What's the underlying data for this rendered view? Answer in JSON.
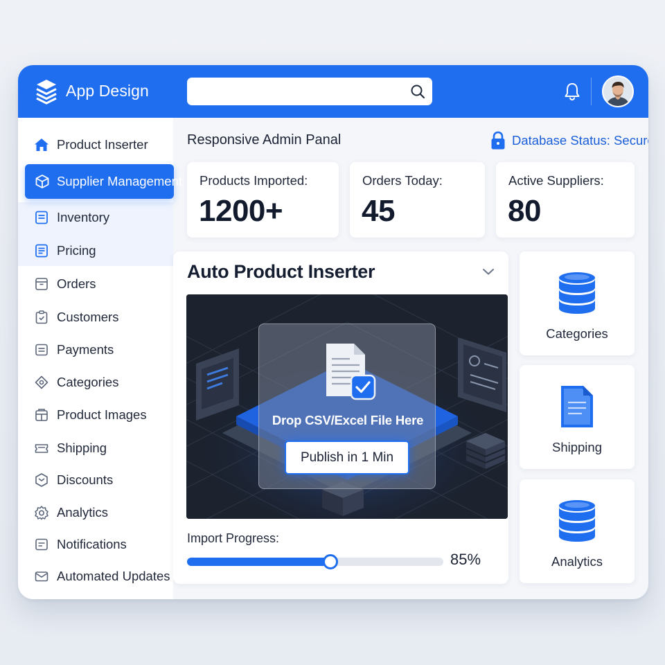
{
  "app": {
    "title": "App Design",
    "logo_icon": "layers-icon"
  },
  "search": {
    "value": "",
    "placeholder": "",
    "icon": "search-icon"
  },
  "header": {
    "notification_icon": "bell-icon",
    "avatar": "user-avatar"
  },
  "sidebar": {
    "active_index": 1,
    "items": [
      {
        "label": "Product Inserter",
        "icon": "home-icon"
      },
      {
        "label": "Supplier Management",
        "icon": "box-icon"
      },
      {
        "label": "Inventory",
        "icon": "list-icon"
      },
      {
        "label": "Pricing",
        "icon": "list-icon"
      },
      {
        "label": "Orders",
        "icon": "tray-icon"
      },
      {
        "label": "Customers",
        "icon": "clipboard-icon"
      },
      {
        "label": "Payments",
        "icon": "card-icon"
      },
      {
        "label": "Categories",
        "icon": "tag-icon"
      },
      {
        "label": "Product Images",
        "icon": "image-icon"
      },
      {
        "label": "Shipping",
        "icon": "truck-icon"
      },
      {
        "label": "Discounts",
        "icon": "badge-icon"
      },
      {
        "label": "Analytics",
        "icon": "gear-icon"
      },
      {
        "label": "Notifications",
        "icon": "message-icon"
      },
      {
        "label": "Automated Updates",
        "icon": "mail-icon"
      }
    ]
  },
  "main": {
    "panel_title": "Responsive Admin Panal",
    "db_status": "Database Status: Secure",
    "stats": [
      {
        "label": "Products Imported:",
        "value": "1200+"
      },
      {
        "label": "Orders Today:",
        "value": "45"
      },
      {
        "label": "Active Suppliers:",
        "value": "80"
      }
    ],
    "inserter": {
      "title": "Auto Product Inserter",
      "drop_text": "Drop CSV/Excel File Here",
      "publish_label": "Publish in 1 Min",
      "progress_label": "Import Progress:",
      "progress_text": "85%",
      "progress_fraction": 0.56
    },
    "tiles": [
      {
        "label": "Categories",
        "icon": "database-icon"
      },
      {
        "label": "Shipping",
        "icon": "document-icon"
      },
      {
        "label": "Analytics",
        "icon": "database-icon"
      }
    ]
  },
  "colors": {
    "accent": "#1f6ef0",
    "status_text": "#1b5fd8",
    "sidebar_active": "#1f6ef0"
  }
}
